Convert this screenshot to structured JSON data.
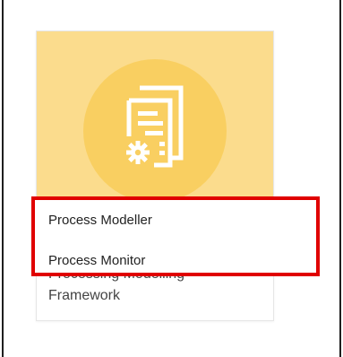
{
  "tile": {
    "icon": "process-document-gear-icon",
    "caption_line1": "Processing Modelling",
    "caption_line2": "Framework",
    "banner_color": "#fbdc8d",
    "circle_color": "#f9cf61"
  },
  "menu": {
    "items": [
      {
        "label": "Process Modeller"
      },
      {
        "label": "Process Monitor"
      }
    ]
  },
  "highlight_color": "#e00000"
}
